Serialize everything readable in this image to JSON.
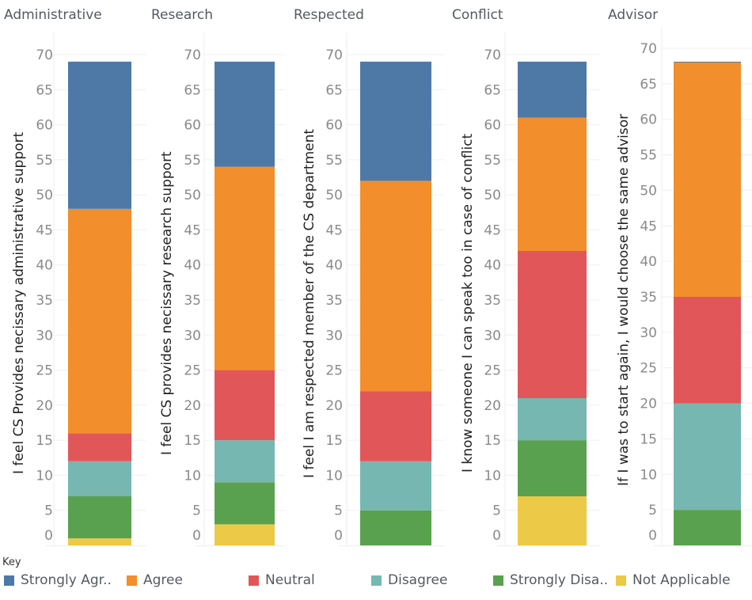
{
  "chart_data": {
    "type": "bar",
    "stacked": true,
    "legend_title": "Key",
    "legend_position": "bottom",
    "legend": [
      {
        "key": "strongly_agree",
        "label": "Strongly Agr..",
        "full_label": "Strongly Agree",
        "color": "#4e79a7"
      },
      {
        "key": "agree",
        "label": "Agree",
        "full_label": "Agree",
        "color": "#f28e2b"
      },
      {
        "key": "neutral",
        "label": "Neutral",
        "full_label": "Neutral",
        "color": "#e15759"
      },
      {
        "key": "disagree",
        "label": "Disagree",
        "full_label": "Disagree",
        "color": "#76b7b2"
      },
      {
        "key": "strongly_disagree",
        "label": "Strongly Disa..",
        "full_label": "Strongly Disagree",
        "color": "#59a14f"
      },
      {
        "key": "not_applicable",
        "label": "Not Applicable",
        "full_label": "Not Applicable",
        "color": "#edc948"
      }
    ],
    "stack_order_bottom_to_top": [
      "not_applicable",
      "strongly_disagree",
      "disagree",
      "neutral",
      "agree",
      "strongly_agree"
    ],
    "grid": true,
    "panels": [
      {
        "title": "Administrative",
        "ylabel": "I feel CS Provides necissary administrative support",
        "ylim": [
          0,
          70
        ],
        "yticks": [
          0,
          5,
          10,
          15,
          20,
          25,
          30,
          35,
          40,
          45,
          50,
          55,
          60,
          65,
          70
        ],
        "values": {
          "not_applicable": 1,
          "strongly_disagree": 6,
          "disagree": 5,
          "neutral": 4,
          "agree": 32,
          "strongly_agree": 21
        }
      },
      {
        "title": "Research",
        "ylabel": "I feel CS provides necissary research support",
        "ylim": [
          0,
          70
        ],
        "yticks": [
          0,
          5,
          10,
          15,
          20,
          25,
          30,
          35,
          40,
          45,
          50,
          55,
          60,
          65,
          70
        ],
        "values": {
          "not_applicable": 3,
          "strongly_disagree": 6,
          "disagree": 6,
          "neutral": 10,
          "agree": 29,
          "strongly_agree": 15
        }
      },
      {
        "title": "Respected",
        "ylabel": "I feel I am respected member of the CS department",
        "ylim": [
          0,
          70
        ],
        "yticks": [
          0,
          5,
          10,
          15,
          20,
          25,
          30,
          35,
          40,
          45,
          50,
          55,
          60,
          65,
          70
        ],
        "values": {
          "not_applicable": 0,
          "strongly_disagree": 5,
          "disagree": 7,
          "neutral": 10,
          "agree": 30,
          "strongly_agree": 17
        }
      },
      {
        "title": "Conflict",
        "ylabel": "I know someone I can speak too in case of conflict",
        "ylim": [
          0,
          70
        ],
        "yticks": [
          0,
          5,
          10,
          15,
          20,
          25,
          30,
          35,
          40,
          45,
          50,
          55,
          60,
          65,
          70
        ],
        "values": {
          "not_applicable": 7,
          "strongly_disagree": 8,
          "disagree": 6,
          "neutral": 21,
          "agree": 19,
          "strongly_agree": 8
        }
      },
      {
        "title": "Advisor",
        "ylabel": "If I was to start again, I would choose the same advisor",
        "ylim": [
          0,
          70
        ],
        "yticks": [
          0,
          5,
          10,
          15,
          20,
          25,
          30,
          35,
          40,
          45,
          50,
          55,
          60,
          65,
          70
        ],
        "values": {
          "not_applicable": 0,
          "strongly_disagree": 5,
          "disagree": 15,
          "neutral": 15,
          "agree": 33,
          "strongly_agree": 0.1
        }
      }
    ]
  }
}
